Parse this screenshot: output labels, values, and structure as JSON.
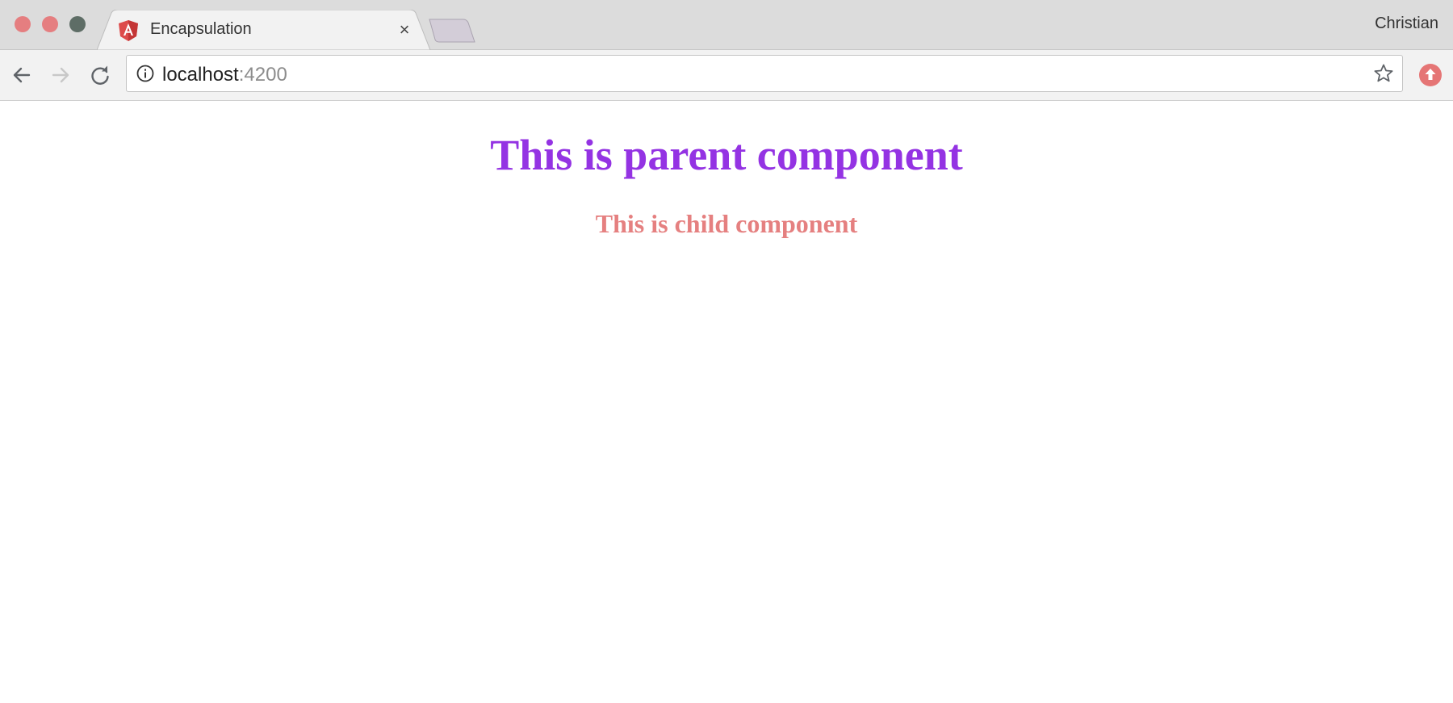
{
  "window": {
    "traffic_lights": {
      "close": "#e57e80",
      "minimize": "#e57e80",
      "zoom": "#5e6d66"
    },
    "profile_name": "Christian"
  },
  "tabs": [
    {
      "title": "Encapsulation",
      "favicon": "angular-icon",
      "active": true,
      "close_glyph": "×"
    }
  ],
  "toolbar": {
    "back_icon": "back-arrow-icon",
    "forward_icon": "forward-arrow-icon",
    "reload_icon": "reload-icon",
    "address": {
      "security_icon": "info-icon",
      "host": "localhost",
      "port": ":4200"
    },
    "bookmark_icon": "star-icon",
    "extension_icon": "extension-icon"
  },
  "page": {
    "parent_heading": "This is parent component",
    "child_heading": "This is child component"
  },
  "colors": {
    "parent_heading": "#9433e3",
    "child_heading": "#e58080",
    "tabstrip": "#dcdcdc",
    "toolbar": "#f2f2f2"
  }
}
